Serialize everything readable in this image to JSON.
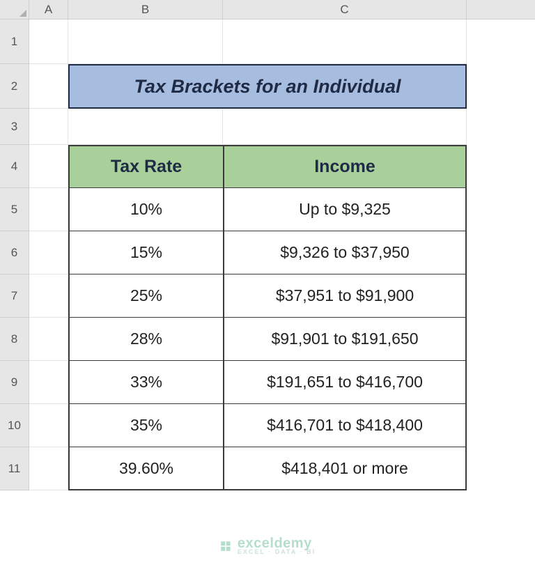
{
  "columns": {
    "A": "A",
    "B": "B",
    "C": "C"
  },
  "rows": [
    "1",
    "2",
    "3",
    "4",
    "5",
    "6",
    "7",
    "8",
    "9",
    "10",
    "11"
  ],
  "title": "Tax Brackets for an Individual",
  "table": {
    "headers": {
      "rate": "Tax Rate",
      "income": "Income"
    },
    "rows": [
      {
        "rate": "10%",
        "income": "Up to $9,325"
      },
      {
        "rate": "15%",
        "income": "$9,326 to $37,950"
      },
      {
        "rate": "25%",
        "income": "$37,951 to $91,900"
      },
      {
        "rate": "28%",
        "income": "$91,901 to $191,650"
      },
      {
        "rate": "33%",
        "income": "$191,651 to $416,700"
      },
      {
        "rate": "35%",
        "income": "$416,701 to $418,400"
      },
      {
        "rate": "39.60%",
        "income": "$418,401 or more"
      }
    ]
  },
  "watermark": {
    "name": "exceldemy",
    "sub": "EXCEL · DATA · BI"
  }
}
